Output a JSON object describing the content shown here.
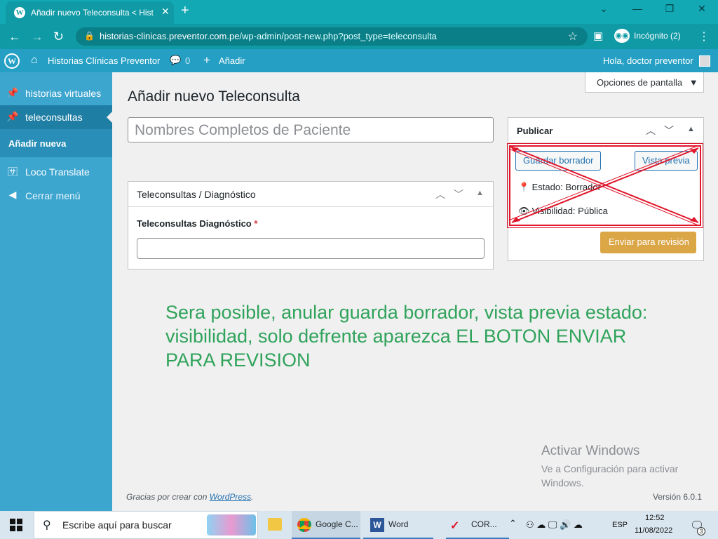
{
  "browser": {
    "tab_title": "Añadir nuevo Teleconsulta < Hist",
    "url_domain": "historias-clinicas.preventor.com.pe",
    "url_path": "/wp-admin/post-new.php?post_type=teleconsulta",
    "incognito_label": "Incógnito (2)"
  },
  "adminbar": {
    "site_name": "Historias Clínicas Preventor",
    "comments_count": "0",
    "new_label": "Añadir",
    "greeting": "Hola, doctor preventor"
  },
  "sidebar": {
    "items": [
      {
        "label": "historias virtuales",
        "icon": "pin-icon"
      },
      {
        "label": "teleconsultas",
        "icon": "pin-icon"
      },
      {
        "label": "Añadir nueva",
        "icon": ""
      },
      {
        "label": "Loco Translate",
        "icon": "translate-icon"
      },
      {
        "label": "Cerrar menú",
        "icon": "collapse-icon"
      }
    ]
  },
  "main": {
    "screen_options": "Opciones de pantalla",
    "page_title": "Añadir nuevo Teleconsulta",
    "title_placeholder": "Nombres Completos de Paciente",
    "diagnostic_box": {
      "title": "Teleconsultas / Diagnóstico",
      "field_label": "Teleconsultas Diagnóstico",
      "required_mark": "*"
    },
    "publish_box": {
      "title": "Publicar",
      "save_draft": "Guardar borrador",
      "preview": "Vista previa",
      "status_label": "Estado:",
      "status_value": "Borrador",
      "visibility_label": "Visibilidad:",
      "visibility_value": "Pública",
      "submit_review": "Enviar para revisión"
    },
    "annotation": "Sera posible, anular guarda borrador, vista previa estado: visibilidad, solo defrente aparezca EL BOTON ENVIAR PARA REVISION",
    "watermark_title": "Activar Windows",
    "watermark_sub": "Ve a Configuración para activar Windows.",
    "footer_text": "Gracias por crear con",
    "footer_link": "WordPress",
    "version": "Versión 6.0.1"
  },
  "taskbar": {
    "search_placeholder": "Escribe aquí para buscar",
    "apps": [
      "Google C...",
      "Word",
      "COR..."
    ],
    "lang": "ESP",
    "time": "12:52",
    "date": "11/08/2022",
    "notifications": "3"
  },
  "colors": {
    "accent": "#25a0c4",
    "annotation": "#2fa35a",
    "highlight": "#e0162b",
    "primary_button": "#dba646"
  }
}
